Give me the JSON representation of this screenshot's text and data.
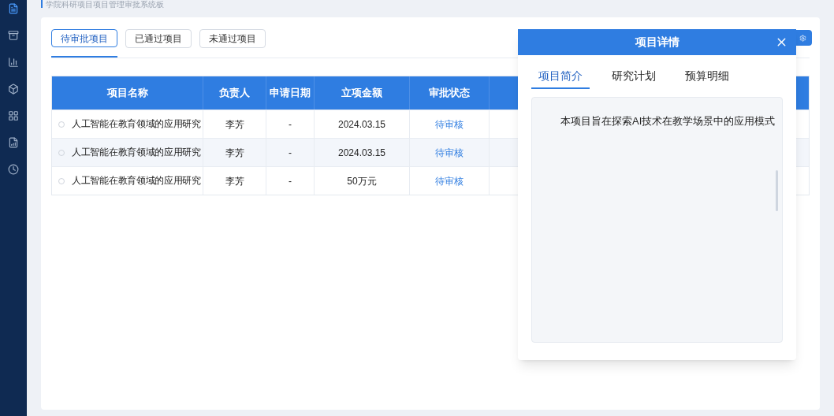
{
  "breadcrumb": "学院科研项目项目管理审批系统板",
  "tabs": [
    {
      "label": "待审批项目",
      "selected": true
    },
    {
      "label": "已通过项目",
      "selected": false
    },
    {
      "label": "未通过项目",
      "selected": false
    }
  ],
  "table": {
    "columns": [
      "项目名称",
      "负责人",
      "申请日期",
      "立项金额",
      "审批状态"
    ],
    "rows": [
      {
        "checked": false,
        "cells": [
          "人工智能在教育领域的应用研究",
          "李芳",
          "-",
          "2024.03.15",
          "待审核"
        ]
      },
      {
        "checked": false,
        "cells": [
          "人工智能在教育领域的应用研究",
          "李芳",
          "-",
          "2024.03.15",
          "待审核"
        ]
      },
      {
        "checked": false,
        "cells": [
          "人工智能在教育领域的应用研究",
          "李芳",
          "-",
          "50万元",
          "待审核"
        ]
      }
    ]
  },
  "dialog": {
    "title": "项目详情",
    "tabs": [
      {
        "label": "项目简介",
        "selected": true
      },
      {
        "label": "研究计划",
        "selected": false
      },
      {
        "label": "预算明细",
        "selected": false
      }
    ],
    "body": "本项目旨在探索AI技术在教学场景中的应用模式"
  }
}
